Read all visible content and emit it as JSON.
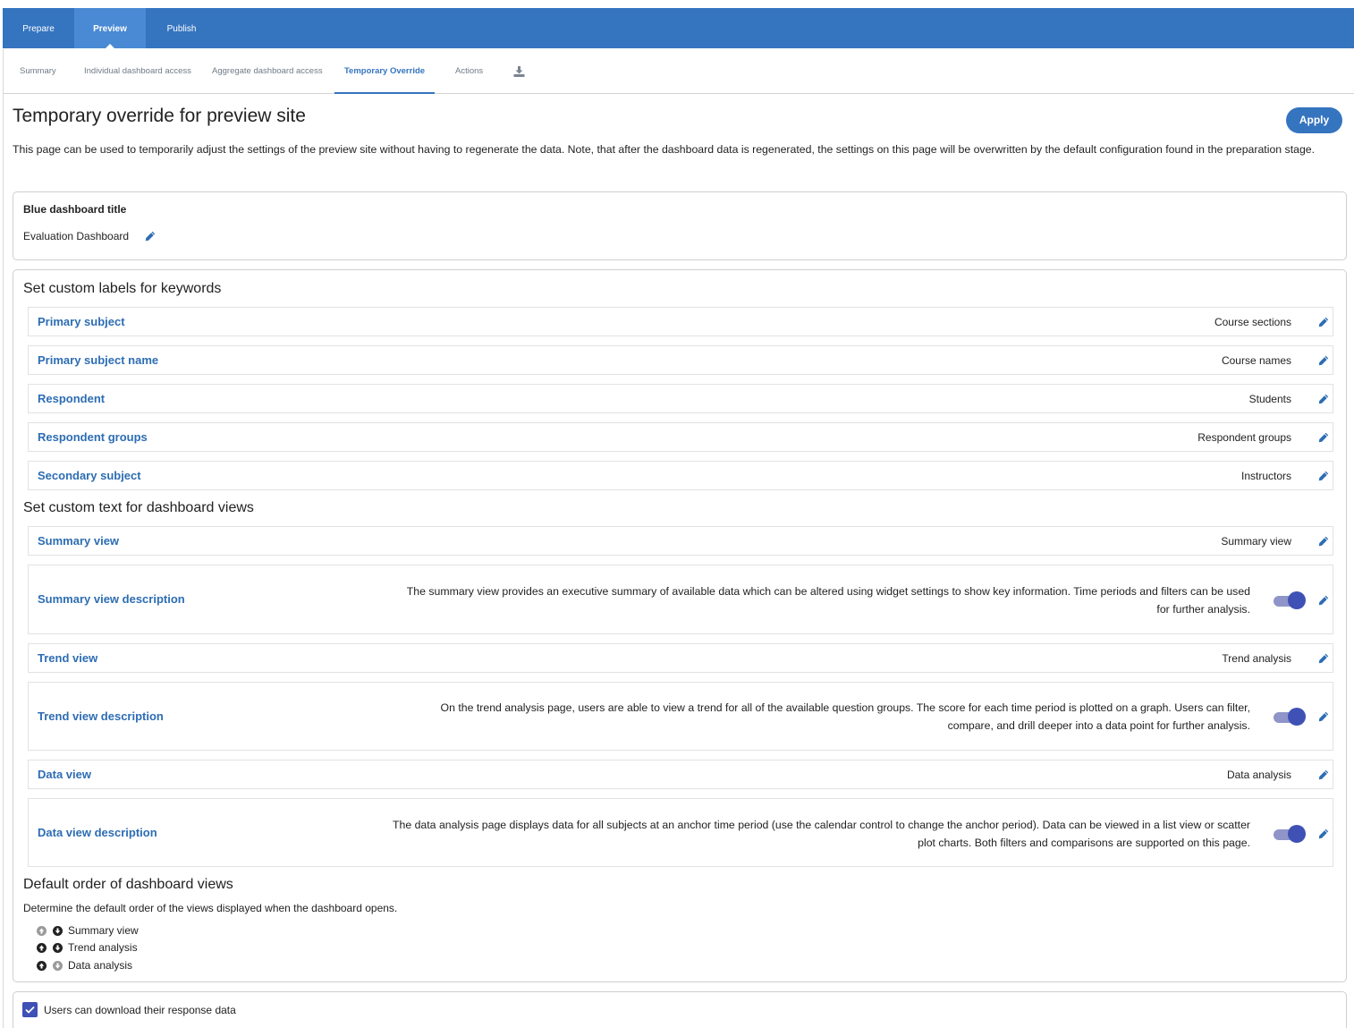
{
  "top_tabs": [
    {
      "label": "Prepare",
      "active": false
    },
    {
      "label": "Preview",
      "active": true
    },
    {
      "label": "Publish",
      "active": false
    }
  ],
  "sub_nav": [
    {
      "label": "Summary",
      "active": false
    },
    {
      "label": "Individual dashboard access",
      "active": false
    },
    {
      "label": "Aggregate dashboard access",
      "active": false
    },
    {
      "label": "Temporary Override",
      "active": true
    },
    {
      "label": "Actions",
      "active": false
    },
    {
      "icon": "download-icon"
    }
  ],
  "page": {
    "title": "Temporary override for preview site",
    "apply_label": "Apply",
    "intro": "This page can be used to temporarily adjust the settings of the preview site without having to regenerate the data. Note, that after the dashboard data is regenerated, the settings on this page will be overwritten by the default configuration found in the preparation stage."
  },
  "dashboard_title": {
    "label": "Blue dashboard title",
    "value": "Evaluation Dashboard",
    "edit_icon": "pencil-icon"
  },
  "keywords": {
    "heading": "Set custom labels for keywords",
    "rows": [
      {
        "label": "Primary subject",
        "value": "Course sections"
      },
      {
        "label": "Primary subject name",
        "value": "Course names"
      },
      {
        "label": "Respondent",
        "value": "Students"
      },
      {
        "label": "Respondent groups",
        "value": "Respondent groups"
      },
      {
        "label": "Secondary subject",
        "value": "Instructors"
      }
    ]
  },
  "views": {
    "heading": "Set custom text for dashboard views",
    "summary": {
      "label": "Summary view",
      "value": "Summary view"
    },
    "summary_desc": {
      "label": "Summary view description",
      "value": "The summary view provides an executive summary of available data which can be altered using widget settings to show key information. Time periods and filters can be used for further analysis.",
      "enabled": true
    },
    "trend": {
      "label": "Trend view",
      "value": "Trend analysis"
    },
    "trend_desc": {
      "label": "Trend view description",
      "value": "On the trend analysis page, users are able to view a trend for all of the available question groups. The score for each time period is plotted on a graph. Users can filter, compare, and drill deeper into a data point for further analysis.",
      "enabled": true
    },
    "data": {
      "label": "Data view",
      "value": "Data analysis"
    },
    "data_desc": {
      "label": "Data view description",
      "value": "The data analysis page displays data for all subjects at an anchor time period (use the calendar control to change the anchor period). Data can be viewed in a list view or scatter plot charts. Both filters and comparisons are supported on this page.",
      "enabled": true
    }
  },
  "order": {
    "heading": "Default order of dashboard views",
    "description": "Determine the default order of the views displayed when the dashboard opens.",
    "items": [
      {
        "label": "Summary view",
        "up_enabled": false,
        "down_enabled": true
      },
      {
        "label": "Trend analysis",
        "up_enabled": true,
        "down_enabled": true
      },
      {
        "label": "Data analysis",
        "up_enabled": true,
        "down_enabled": false
      }
    ]
  },
  "download": {
    "label": "Users can download their response data",
    "checked": true
  },
  "colors": {
    "brand": "#3574bf",
    "link": "#2d6db3",
    "toggle": "#3f51b5"
  }
}
